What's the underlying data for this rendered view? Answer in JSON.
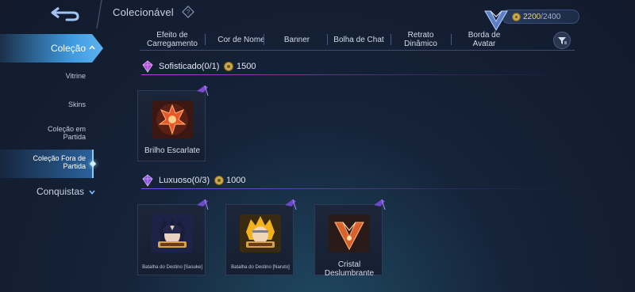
{
  "header": {
    "title": "Colecionável",
    "points": {
      "current": "2200",
      "max": "/2400"
    }
  },
  "sidebar": {
    "active": {
      "label": "Coleção"
    },
    "items": [
      {
        "label": "Vitrine"
      },
      {
        "label": "Skins"
      },
      {
        "label": "Coleção em Partida"
      },
      {
        "label": "Coleção Fora de Partida"
      }
    ],
    "conquistas": {
      "label": "Conquistas"
    }
  },
  "tabs": [
    {
      "label": "Efeito de Carregamento"
    },
    {
      "label": "Cor de Nome"
    },
    {
      "label": "Banner"
    },
    {
      "label": "Bolha de Chat"
    },
    {
      "label": "Retrato Dinâmico"
    },
    {
      "label": "Borda de Avatar"
    }
  ],
  "sections": [
    {
      "title": "Sofisticado(0/1)",
      "price": "1500",
      "accent": "#b04ad6",
      "items": [
        {
          "name": "Brilho Escarlate"
        }
      ]
    },
    {
      "title": "Luxuoso(0/3)",
      "price": "1000",
      "accent": "#8a4ee0",
      "items": [
        {
          "name": "Batalha do Destino [Sasuke]"
        },
        {
          "name": "Batalha do Destino [Naruto]"
        },
        {
          "name": "Cristal Deslumbrante"
        }
      ]
    }
  ],
  "colors": {
    "active_tab": "#3f9be0",
    "gold": "#c9a94c",
    "background": "#152238"
  }
}
